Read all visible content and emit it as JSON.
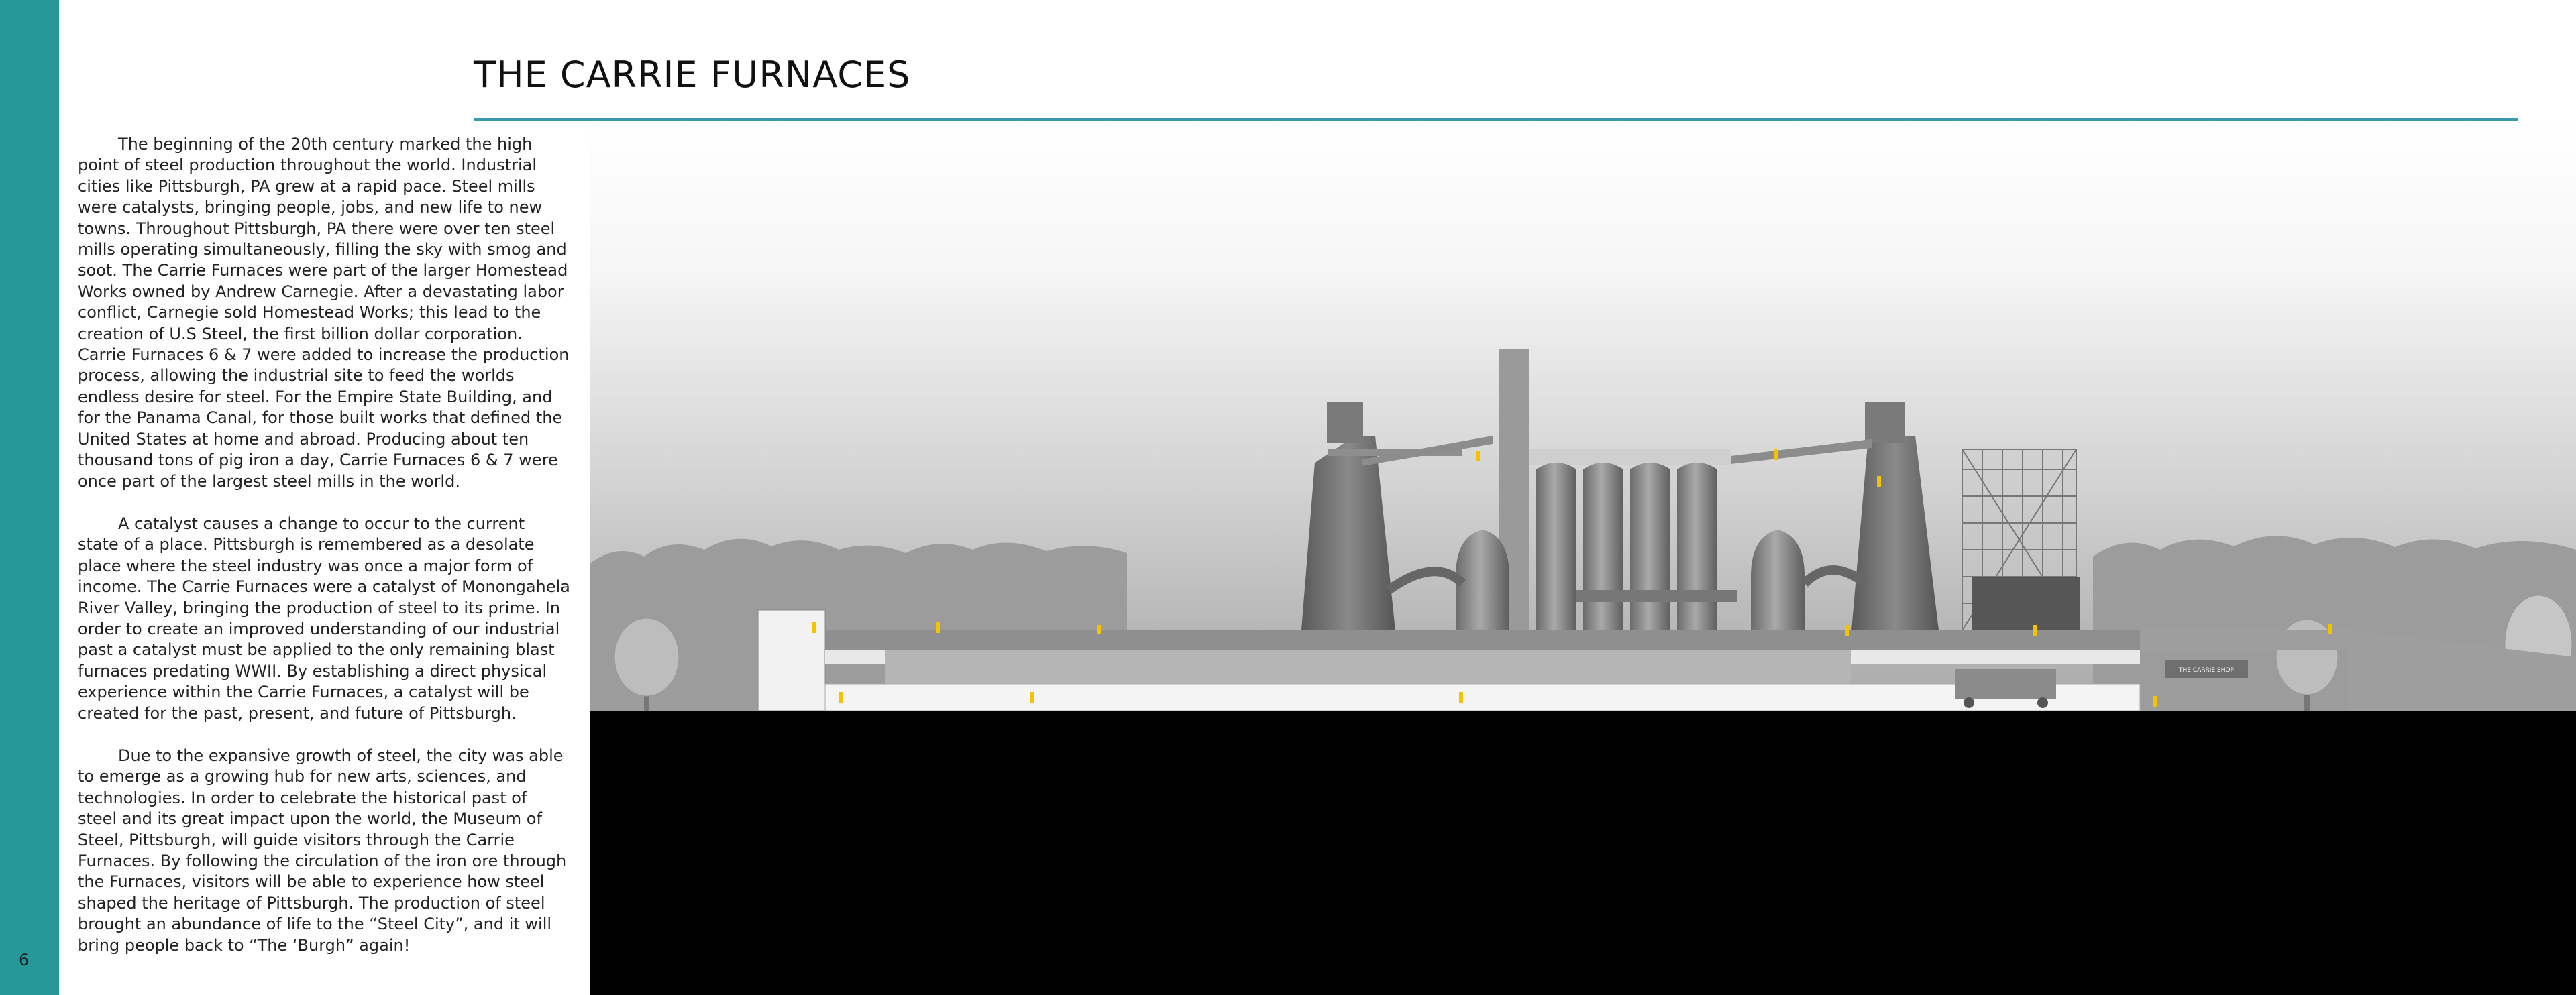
{
  "page": {
    "title": "THE CARRIE FURNACES",
    "page_number": "6",
    "colors": {
      "sidebar": "#26989a",
      "rule": "#3a9aa8",
      "text": "#222222",
      "figure_accent": "#f2c400"
    }
  },
  "text": {
    "paragraphs": [
      "The beginning of the 20th century marked the high point of steel production throughout the world. Industrial cities like Pittsburgh, PA grew at a rapid pace. Steel mills were catalysts, bringing people, jobs, and new life to new towns. Throughout Pittsburgh, PA there were over ten steel mills operating simultaneously, filling the sky with smog and soot. The Carrie Furnaces were part of the larger Homestead Works owned by Andrew Carnegie. After a devastating labor conflict, Carnegie sold Homestead Works; this lead to the creation of U.S Steel, the first billion dollar corporation. Carrie Furnaces 6 & 7 were added to increase the production process, allowing the industrial site to feed the worlds endless desire for steel. For the Empire State Building, and for the Panama Canal, for those built works that defined the United States at home and abroad. Producing about ten thousand tons of pig iron a day, Carrie Furnaces 6 & 7 were once part of the largest steel mills in the world.",
      "A catalyst causes a change to occur to the current state of a place. Pittsburgh is remembered as a desolate place where the steel industry was once a major form of income. The Carrie Furnaces were a catalyst of Monongahela River Valley, bringing the production of steel to its prime. In order to create an improved understanding of our industrial past a catalyst must be applied to the only remaining blast furnaces predating WWII. By establishing a direct physical experience within the Carrie Furnaces, a catalyst will be created for the past, present, and future of Pittsburgh.",
      "Due to the expansive growth of steel, the city was able to emerge as a growing hub for new arts, sciences, and technologies. In order to celebrate the historical past of steel and its great impact upon the world, the Museum of Steel, Pittsburgh, will guide visitors through the Carrie Furnaces. By following the circulation of the iron ore through the Furnaces, visitors will be able to experience how steel shaped the heritage of Pittsburgh. The production of steel brought an abundance of life to the “Steel City”, and it will bring people back to “The ‘Burgh” again!"
    ]
  },
  "figure": {
    "sign_label": "THE CARRIE SHOP"
  }
}
